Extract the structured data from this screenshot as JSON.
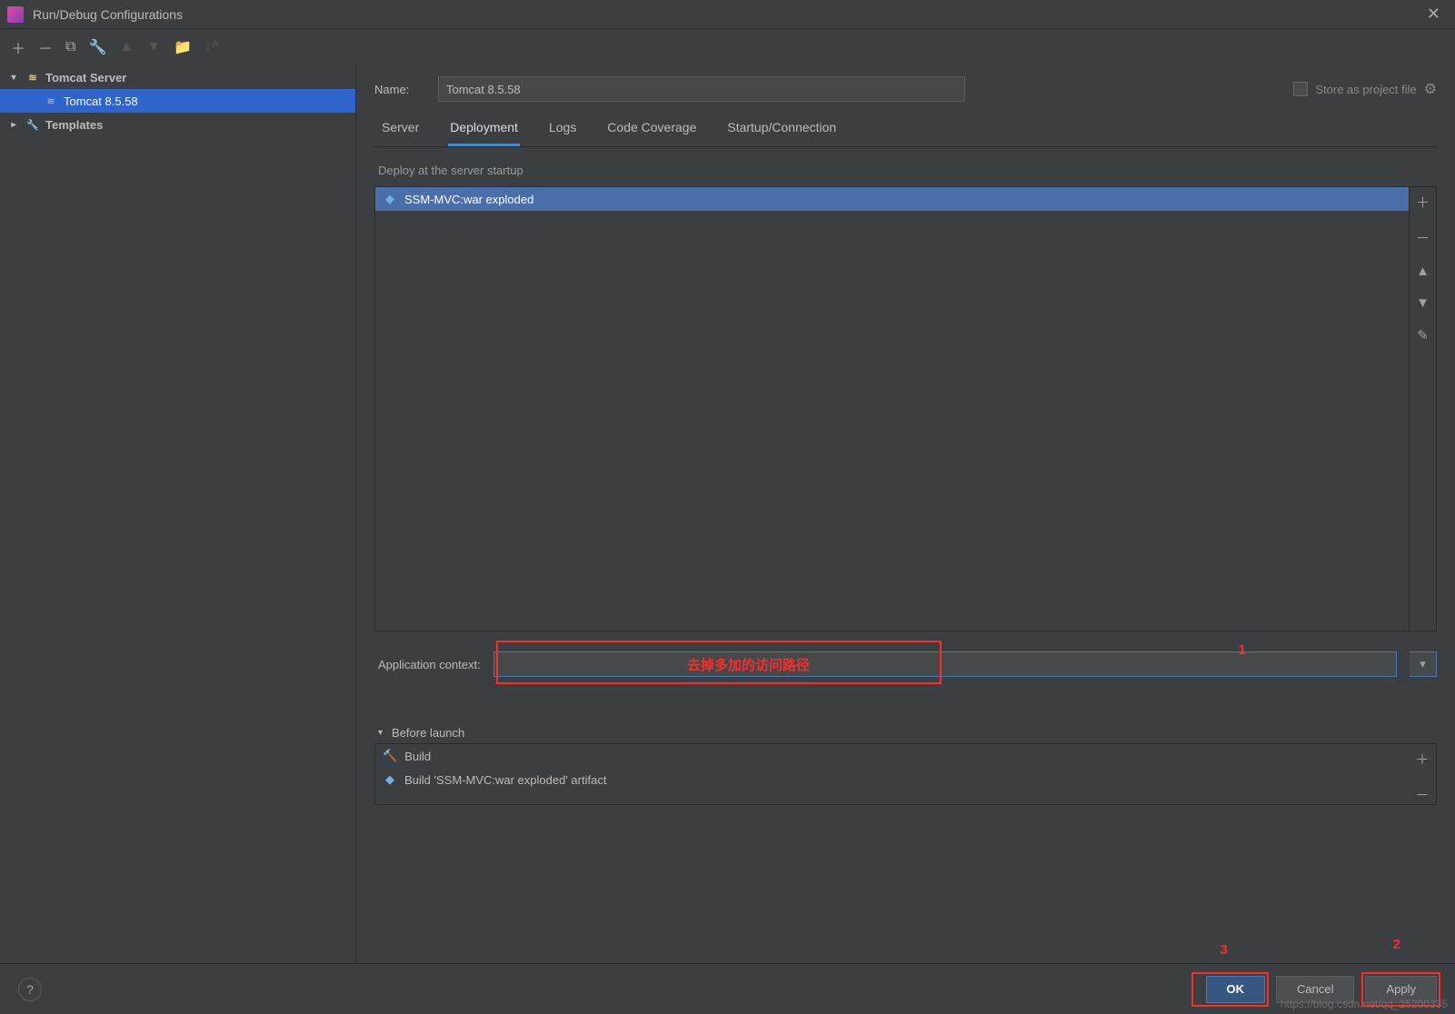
{
  "window": {
    "title": "Run/Debug Configurations"
  },
  "tree": {
    "tomcat_server": "Tomcat Server",
    "tomcat_item": "Tomcat 8.5.58",
    "templates": "Templates"
  },
  "form": {
    "name_label": "Name:",
    "name_value": "Tomcat 8.5.58",
    "store_label": "Store as project file"
  },
  "tabs": {
    "server": "Server",
    "deployment": "Deployment",
    "logs": "Logs",
    "code_coverage": "Code Coverage",
    "startup": "Startup/Connection"
  },
  "deploy": {
    "section": "Deploy at the server startup",
    "artifact": "SSM-MVC:war exploded"
  },
  "appctx": {
    "label": "Application context:",
    "value": ""
  },
  "annotations": {
    "overlay_text": "去掉多加的访问路径",
    "n1": "1",
    "n2": "2",
    "n3": "3"
  },
  "before_launch": {
    "header": "Before launch",
    "build": "Build",
    "artifact": "Build 'SSM-MVC:war exploded' artifact"
  },
  "footer": {
    "ok": "OK",
    "cancel": "Cancel",
    "apply": "Apply"
  },
  "watermark": "https://blog.csdn.net/qq_25200335"
}
